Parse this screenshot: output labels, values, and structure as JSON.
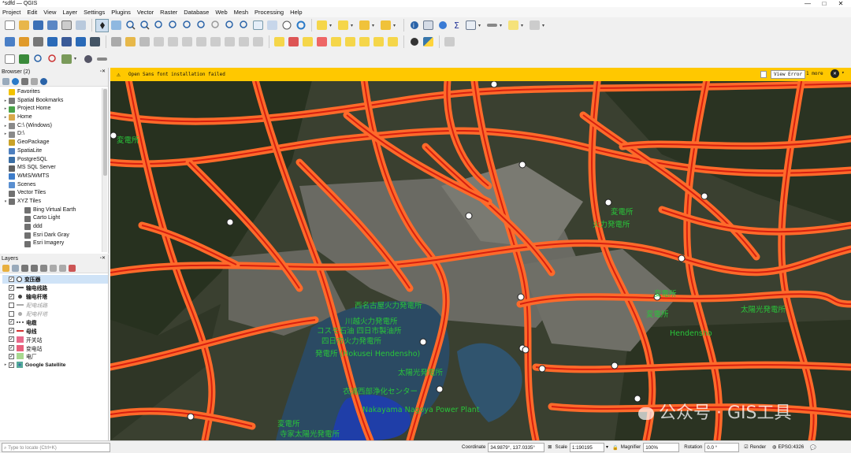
{
  "window": {
    "title": "*sdfd — QGIS",
    "controls": [
      "—",
      "□",
      "✕"
    ]
  },
  "menu": [
    "Project",
    "Edit",
    "View",
    "Layer",
    "Settings",
    "Plugins",
    "Vector",
    "Raster",
    "Database",
    "Web",
    "Mesh",
    "Processing",
    "Help"
  ],
  "message_bar": {
    "text": "Open Sans font installation failed",
    "view_button": "View Error",
    "more": "1 more"
  },
  "browser": {
    "title": "Browser (2)",
    "items": [
      {
        "label": "Favorites",
        "icon": "star-icon",
        "arrow": "",
        "indent": 0,
        "color": "#f2c200"
      },
      {
        "label": "Spatial Bookmarks",
        "icon": "bookmark-icon",
        "arrow": "▸",
        "indent": 0,
        "color": "#7a7a7a"
      },
      {
        "label": "Project Home",
        "icon": "folder-icon",
        "arrow": "▸",
        "indent": 0,
        "color": "#4aa34a"
      },
      {
        "label": "Home",
        "icon": "folder-icon",
        "arrow": "▸",
        "indent": 0,
        "color": "#d9a94a"
      },
      {
        "label": "C:\\ (Windows)",
        "icon": "drive-icon",
        "arrow": "▸",
        "indent": 0,
        "color": "#8a8a8a"
      },
      {
        "label": "D:\\",
        "icon": "drive-icon",
        "arrow": "▸",
        "indent": 0,
        "color": "#8a8a8a"
      },
      {
        "label": "GeoPackage",
        "icon": "geopackage-icon",
        "arrow": "",
        "indent": 0,
        "color": "#c9a227"
      },
      {
        "label": "SpatiaLite",
        "icon": "spatialite-icon",
        "arrow": "",
        "indent": 0,
        "color": "#4d7fbf"
      },
      {
        "label": "PostgreSQL",
        "icon": "postgresql-icon",
        "arrow": "",
        "indent": 0,
        "color": "#3a6ea5"
      },
      {
        "label": "MS SQL Server",
        "icon": "mssql-icon",
        "arrow": "",
        "indent": 0,
        "color": "#606060"
      },
      {
        "label": "WMS/WMTS",
        "icon": "globe-icon",
        "arrow": "",
        "indent": 0,
        "color": "#3d7cc9"
      },
      {
        "label": "Scenes",
        "icon": "scenes-icon",
        "arrow": "",
        "indent": 0,
        "color": "#5a8fd0"
      },
      {
        "label": "Vector Tiles",
        "icon": "grid-icon",
        "arrow": "",
        "indent": 0,
        "color": "#707070"
      },
      {
        "label": "XYZ Tiles",
        "icon": "grid-icon",
        "arrow": "▾",
        "indent": 0,
        "color": "#707070"
      },
      {
        "label": "Bing Virtual Earth",
        "icon": "grid-icon",
        "arrow": "",
        "indent": 1,
        "color": "#707070"
      },
      {
        "label": "Carto Light",
        "icon": "grid-icon",
        "arrow": "",
        "indent": 1,
        "color": "#707070"
      },
      {
        "label": "ddd",
        "icon": "grid-icon",
        "arrow": "",
        "indent": 1,
        "color": "#707070"
      },
      {
        "label": "Esri Dark Gray",
        "icon": "grid-icon",
        "arrow": "",
        "indent": 1,
        "color": "#707070"
      },
      {
        "label": "Esri Imagery",
        "icon": "grid-icon",
        "arrow": "",
        "indent": 1,
        "color": "#707070"
      }
    ]
  },
  "layers": {
    "title": "Layers",
    "items": [
      {
        "label": "变压器",
        "checked": true,
        "sym": "circle",
        "color": "#ffffff",
        "bold": true,
        "greyed": false,
        "selected": true
      },
      {
        "label": "输电线路",
        "checked": true,
        "sym": "line",
        "color": "#555555",
        "bold": true,
        "greyed": false,
        "selected": false
      },
      {
        "label": "输电杆塔",
        "checked": true,
        "sym": "dot",
        "color": "#444444",
        "bold": true,
        "greyed": false,
        "selected": false
      },
      {
        "label": "配电线路",
        "checked": false,
        "sym": "line",
        "color": "#aaaaaa",
        "bold": false,
        "greyed": true,
        "selected": false
      },
      {
        "label": "配电杆塔",
        "checked": false,
        "sym": "dot",
        "color": "#aaaaaa",
        "bold": false,
        "greyed": true,
        "selected": false
      },
      {
        "label": "电缆",
        "checked": true,
        "sym": "dash",
        "color": "#666666",
        "bold": true,
        "greyed": false,
        "selected": false
      },
      {
        "label": "母线",
        "checked": true,
        "sym": "line",
        "color": "#d43030",
        "bold": true,
        "greyed": false,
        "selected": false
      },
      {
        "label": "开关站",
        "checked": true,
        "sym": "fill",
        "color": "#e86a8a",
        "bold": false,
        "greyed": false,
        "selected": false
      },
      {
        "label": "变电站",
        "checked": true,
        "sym": "fill",
        "color": "#e8607c",
        "bold": false,
        "greyed": false,
        "selected": false
      },
      {
        "label": "电厂",
        "checked": true,
        "sym": "fill",
        "color": "#a8d890",
        "bold": false,
        "greyed": false,
        "selected": false
      },
      {
        "label": "Google Satellite",
        "checked": true,
        "sym": "xyz",
        "color": "#3a6ea5",
        "bold": true,
        "greyed": false,
        "selected": false
      }
    ]
  },
  "map_labels": [
    "変電所",
    "西名古屋火力発電所",
    "川越火力発電所",
    "コスモ石油 四日市製油所",
    "四日市火力発電所",
    "発電所 (Hokusei Hendensho)",
    "太陽光発電所",
    "衣浦西部浄化センター",
    "Nakayama Nagoya Power Plant",
    "変電所",
    "寺家太陽光発電所",
    "火力発電所",
    "変電所",
    "Hendensho",
    "変電所",
    "太陽光発電所",
    "変電所"
  ],
  "watermark": "公众号 · GIS工具",
  "status": {
    "locate_placeholder": "Type to locate (Ctrl+K)",
    "coordinate_label": "Coordinate",
    "coordinate": "34.9879°, 137.0335°",
    "scale_label": "Scale",
    "scale": "1:190195",
    "magnifier_label": "Magnifier",
    "magnifier": "100%",
    "rotation_label": "Rotation",
    "rotation": "0.0 °",
    "render_label": "Render",
    "crs": "EPSG:4326"
  },
  "colors": {
    "accent": "#ffc800",
    "power_line": "#ff6a2a",
    "power_core": "#d61f10",
    "label_green": "#29c43a"
  }
}
